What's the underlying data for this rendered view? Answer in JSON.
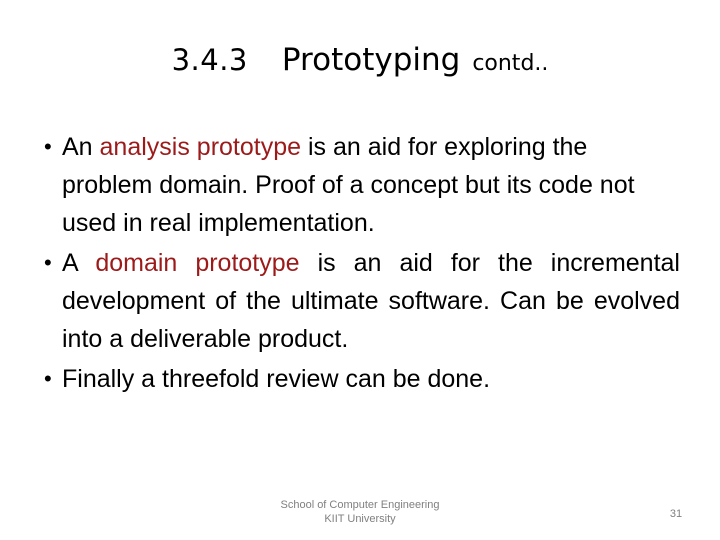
{
  "slide": {
    "title": {
      "number": "3.4.3",
      "main": "Prototyping",
      "suffix": "contd.."
    },
    "bullets": [
      {
        "marker": "•",
        "segments": [
          {
            "text": "An ",
            "emphasis": false
          },
          {
            "text": "analysis prototype",
            "emphasis": true
          },
          {
            "text": "  is an aid for exploring the problem domain. Proof of a concept but its code not used in real implementation.",
            "emphasis": false
          }
        ],
        "plain": "An analysis prototype  is an aid for exploring the problem domain. Proof of a concept but its code not used in real implementation.",
        "justified": false
      },
      {
        "marker": "•",
        "segments": [
          {
            "text": "A ",
            "emphasis": false
          },
          {
            "text": "domain prototype",
            "emphasis": true
          },
          {
            "text": " is an aid for the incremental development of the ultimate software. Can be evolved into a deliverable product.",
            "emphasis": false
          }
        ],
        "plain": "A domain prototype is an aid for the incremental development of the ultimate software. Can be evolved into a deliverable product.",
        "justified": true
      },
      {
        "marker": "•",
        "segments": [
          {
            "text": "Finally a threefold review can be done.",
            "emphasis": false
          }
        ],
        "plain": "Finally a threefold review can be done.",
        "justified": false
      }
    ],
    "footer": {
      "line1": "School of Computer Engineering",
      "line2": "KIIT University",
      "page_number": "31"
    },
    "colors": {
      "text": "#000000",
      "emphasis": "#9C1A1A",
      "footer": "#808080",
      "background": "#ffffff"
    }
  }
}
